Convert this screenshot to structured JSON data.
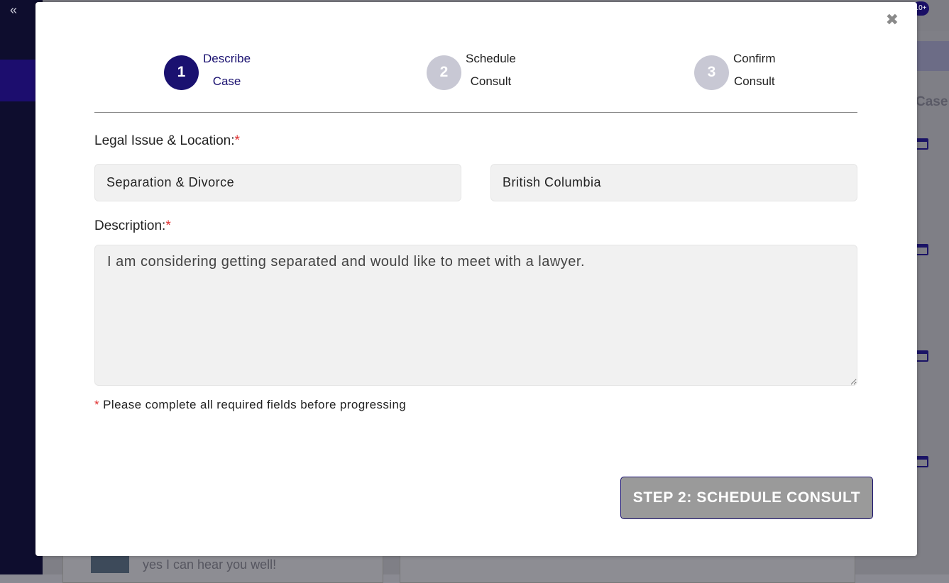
{
  "background": {
    "collapse_glyph": "«",
    "notification_badge": "10+",
    "case_heading_partial": "Case",
    "chat_preview": "yes I can hear you well!"
  },
  "modal": {
    "close_glyph": "✖",
    "steps": [
      {
        "number": "1",
        "line1": "Describe",
        "line2": "Case",
        "state": "active"
      },
      {
        "number": "2",
        "line1": "Schedule",
        "line2": "Consult",
        "state": "inactive"
      },
      {
        "number": "3",
        "line1": "Confirm",
        "line2": "Consult",
        "state": "inactive"
      }
    ],
    "legal_issue_label": "Legal Issue & Location:",
    "required_marker": "*",
    "legal_issue_value": "Separation & Divorce",
    "location_value": "British Columbia",
    "description_label": "Description:",
    "description_value": "I am considering getting separated and would like to meet with a lawyer.",
    "required_note": "Please complete all required fields before progressing",
    "next_button": "STEP 2: SCHEDULE CONSULT"
  },
  "colors": {
    "accent": "#1a1170",
    "inactive_step": "#c8c8d4",
    "required": "#e03030",
    "button_disabled": "#9a9a9a"
  }
}
